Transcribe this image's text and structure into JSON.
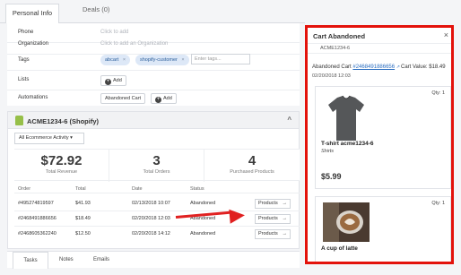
{
  "tabs": {
    "personal": "Personal Info",
    "deals": "Deals (0)"
  },
  "fields": {
    "phone": {
      "label": "Phone",
      "placeholder": "Click to add"
    },
    "organization": {
      "label": "Organization",
      "placeholder": "Click to add an Organization"
    },
    "tags": {
      "label": "Tags",
      "items": [
        "abcart",
        "shopify-customer"
      ],
      "remove_glyph": "×",
      "input_placeholder": "Enter tags..."
    },
    "lists": {
      "label": "Lists",
      "add_label": "Add"
    },
    "automations": {
      "label": "Automations",
      "value": "Abandoned Cart",
      "add_label": "Add"
    }
  },
  "shop": {
    "title": "ACME1234-6 (Shopify)",
    "chevron": "^",
    "activity_select": "All Ecommerce Activity ▾",
    "stats": [
      {
        "value": "$72.92",
        "caption": "Total Revenue"
      },
      {
        "value": "3",
        "caption": "Total Orders"
      },
      {
        "value": "4",
        "caption": "Purchased Products"
      }
    ],
    "table_headers": {
      "order": "Order",
      "total": "Total",
      "date": "Date",
      "status": "Status"
    },
    "orders": [
      {
        "order": "#495274819597",
        "total": "$41.93",
        "date": "02/13/2018 10:07",
        "status": "Abandoned",
        "button": "Products"
      },
      {
        "order": "#2468491886656",
        "total": "$18.49",
        "date": "02/20/2018 12:03",
        "status": "Abandoned",
        "button": "Products"
      },
      {
        "order": "#2468605362240",
        "total": "$12.50",
        "date": "02/20/2018 14:12",
        "status": "Abandoned",
        "button": "Products"
      }
    ],
    "arrow_glyph": "→"
  },
  "bottom_tabs": {
    "tasks": "Tasks",
    "notes": "Notes",
    "emails": "Emails"
  },
  "sidebar": {
    "title": "Cart Abandoned",
    "close": "×",
    "store": "ACME1234-6",
    "cart_label": "Abandoned Cart",
    "cart_link": "#2468491886656",
    "cart_value": "Cart Value: $18.49",
    "date": "02/20/2018 12:03",
    "products": [
      {
        "qty": "Qty: 1",
        "name": "T-shirt acme1234-6",
        "category": "Shirts",
        "price": "$5.99"
      },
      {
        "qty": "Qty: 1",
        "name": "A cup of latte"
      }
    ]
  },
  "colors": {
    "highlight": "#e3120b",
    "link": "#2a6dc0",
    "tag_bg": "#dde8f7"
  }
}
